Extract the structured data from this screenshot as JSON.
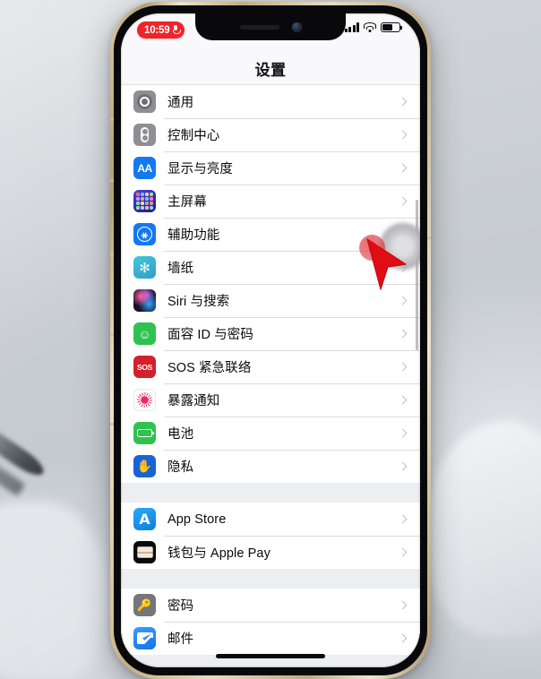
{
  "status_bar": {
    "time": "10:59",
    "recording_icon": "microphone-icon",
    "signal_icon": "cellular-signal-icon",
    "wifi_icon": "wifi-icon",
    "battery_icon": "battery-icon"
  },
  "nav": {
    "title": "设置"
  },
  "groups": [
    {
      "rows": [
        {
          "label": "通用",
          "icon": "gear-icon",
          "icon_color": "#8e8e93"
        },
        {
          "label": "控制中心",
          "icon": "control-center-icon",
          "icon_color": "#8e8e93"
        },
        {
          "label": "显示与亮度",
          "icon": "display-brightness-icon",
          "icon_color": "#1478f0"
        },
        {
          "label": "主屏幕",
          "icon": "home-screen-icon",
          "icon_color": "#2c2ca8"
        },
        {
          "label": "辅助功能",
          "icon": "accessibility-icon",
          "icon_color": "#1478f0"
        },
        {
          "label": "墙纸",
          "icon": "wallpaper-icon",
          "icon_color": "#31b3c9"
        },
        {
          "label": "Siri 与搜索",
          "icon": "siri-icon",
          "icon_color": "#141028"
        },
        {
          "label": "面容 ID 与密码",
          "icon": "face-id-icon",
          "icon_color": "#30c24f"
        },
        {
          "label": "SOS 紧急联络",
          "icon": "sos-icon",
          "icon_color": "#d3202a"
        },
        {
          "label": "暴露通知",
          "icon": "exposure-notification-icon",
          "icon_color": "#ffffff"
        },
        {
          "label": "电池",
          "icon": "battery-settings-icon",
          "icon_color": "#30c24f"
        },
        {
          "label": "隐私",
          "icon": "privacy-hand-icon",
          "icon_color": "#1863d8"
        }
      ]
    },
    {
      "rows": [
        {
          "label": "App Store",
          "icon": "app-store-icon",
          "icon_color": "#1d9bf0"
        },
        {
          "label": "钱包与 Apple Pay",
          "icon": "wallet-icon",
          "icon_color": "#0a0a0a"
        }
      ]
    },
    {
      "rows": [
        {
          "label": "密码",
          "icon": "passwords-key-icon",
          "icon_color": "#75757a"
        },
        {
          "label": "邮件",
          "icon": "mail-icon",
          "icon_color": "#1d7df2"
        }
      ]
    }
  ],
  "overlay": {
    "assistive_touch": "assistive-touch-button",
    "cursor": "red-pointer-cursor",
    "tap_highlight": "tap-highlight-circle"
  },
  "colors": {
    "accent_blue": "#1478f0",
    "record_red": "#f0232a",
    "group_bg": "#eceef2",
    "row_bg": "#ffffff"
  }
}
